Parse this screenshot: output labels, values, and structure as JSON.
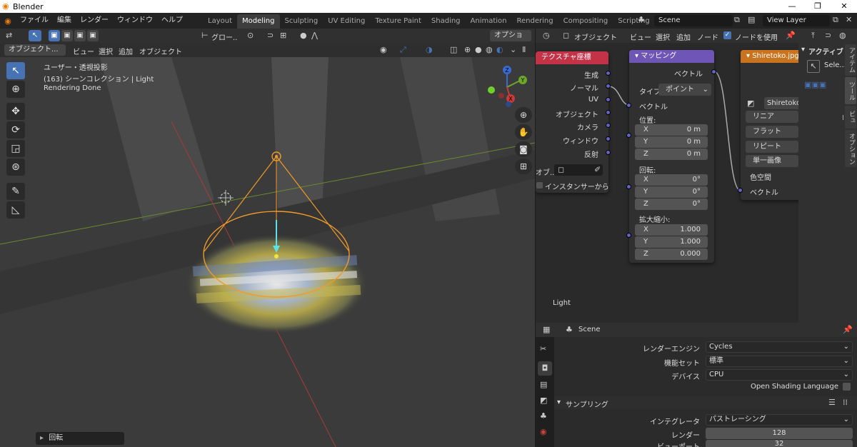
{
  "app": {
    "title": "Blender"
  },
  "menu": [
    "ファイル",
    "編集",
    "レンダー",
    "ウィンドウ",
    "ヘルプ"
  ],
  "workspaces": [
    "Layout",
    "Modeling",
    "Sculpting",
    "UV Editing",
    "Texture Paint",
    "Shading",
    "Animation",
    "Rendering",
    "Compositing",
    "Scripting"
  ],
  "active_workspace": "Modeling",
  "scene": {
    "name": "Scene",
    "view_layer": "View Layer"
  },
  "viewport": {
    "header": {
      "transform": "グロー..",
      "options": "オプション"
    },
    "mode": "オブジェクト...",
    "menus": [
      "ビュー",
      "選択",
      "追加",
      "オブジェクト"
    ],
    "overlay": {
      "line1": "ユーザー・透視投影",
      "line2": "(163) シーンコレクション | Light",
      "line3": "Rendering Done"
    },
    "gizmo": {
      "z": "Z",
      "y": "Y",
      "x": "X"
    },
    "operator_panel": "回転"
  },
  "node_editor": {
    "header": {
      "type": "オブジェクト",
      "menus": [
        "ビュー",
        "選択",
        "追加",
        "ノード"
      ],
      "use_nodes": "ノードを使用"
    },
    "footer_label": "Light",
    "texcoord": {
      "title": "テクスチャ座標",
      "outputs": [
        "生成",
        "ノーマル",
        "UV",
        "オブジェクト",
        "カメラ",
        "ウィンドウ",
        "反射"
      ],
      "object_label": "オブ..",
      "instancer": "インスタンサーから"
    },
    "mapping": {
      "title": "マッピング",
      "out": "ベクトル",
      "type_label": "タイプ:",
      "type_value": "ポイント",
      "vector_in": "ベクトル",
      "location": {
        "label": "位置:",
        "x": "0 m",
        "y": "0 m",
        "z": "0 m"
      },
      "rotation": {
        "label": "回転:",
        "x": "0°",
        "y": "0°",
        "z": "0°"
      },
      "scale": {
        "label": "拡大縮小:",
        "x": "1.000",
        "y": "1.000",
        "z": "0.000"
      },
      "axes": [
        "X",
        "Y",
        "Z"
      ]
    },
    "image": {
      "title": "Shiretoko.jpg",
      "file": "Shiretoko.",
      "options": [
        "リニア",
        "フラット",
        "リピート",
        "単一画像"
      ],
      "colorspace": "色空間",
      "vector": "ベクトル"
    }
  },
  "sidebar": {
    "active_label": "アクティブ",
    "select_label": "Sele...",
    "tabs": [
      "アイテム",
      "ツール",
      "ビュー",
      "オプション"
    ]
  },
  "properties": {
    "context": "Scene",
    "render_engine": {
      "label": "レンダーエンジン",
      "value": "Cycles"
    },
    "feature_set": {
      "label": "機能セット",
      "value": "標準"
    },
    "device": {
      "label": "デバイス",
      "value": "CPU"
    },
    "osl": "Open Shading Language",
    "sampling": {
      "title": "サンプリング",
      "integrator_label": "インテグレータ",
      "integrator": "パストレーシング",
      "render_label": "レンダー",
      "render": "128",
      "viewport_label": "ビューポート",
      "viewport": "32"
    }
  },
  "colors": {
    "accent": "#4772b3",
    "light_orange": "#f09a28",
    "texcoord_header": "#c33247",
    "mapping_header": "#6f56b6",
    "image_header": "#c9731e",
    "socket": "#6363c7"
  }
}
